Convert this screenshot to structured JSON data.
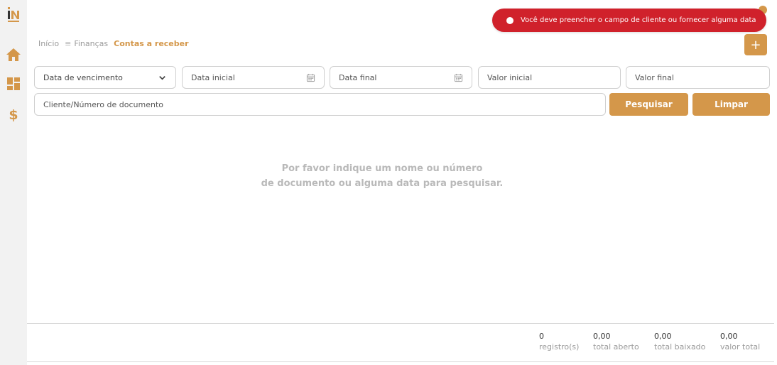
{
  "app": {
    "logo_text": "IN",
    "brand_color": "#d4974a",
    "error_color": "#d0212b"
  },
  "sidebar": {
    "items": [
      {
        "name": "home",
        "icon": "home-icon"
      },
      {
        "name": "dashboard",
        "icon": "dashboard-icon"
      },
      {
        "name": "finance",
        "icon": "dollar-icon"
      }
    ]
  },
  "breadcrumb": {
    "home": "Início",
    "menu_glyph": "≡",
    "section": "Finanças",
    "current": "Contas a receber"
  },
  "toast": {
    "message": "Você deve preencher o campo de cliente ou fornecer alguma data"
  },
  "add_button": {
    "label": "+"
  },
  "filters": {
    "date_type": {
      "selected": "Data de vencimento"
    },
    "start_date": {
      "placeholder": "Data inicial"
    },
    "end_date": {
      "placeholder": "Data final"
    },
    "min_value": {
      "placeholder": "Valor inicial"
    },
    "max_value": {
      "placeholder": "Valor final"
    },
    "client": {
      "placeholder": "Cliente/Número de documento"
    }
  },
  "actions": {
    "search_label": "Pesquisar",
    "clear_label": "Limpar"
  },
  "empty_state": {
    "line1": "Por favor indique um nome ou número",
    "line2": "de documento ou alguma data para pesquisar."
  },
  "footer": {
    "records": {
      "value": "0",
      "label": "registro(s)"
    },
    "total_open": {
      "value": "0,00",
      "label": "total aberto"
    },
    "total_settled": {
      "value": "0,00",
      "label": "total baixado"
    },
    "total_value": {
      "value": "0,00",
      "label": "valor total"
    }
  }
}
